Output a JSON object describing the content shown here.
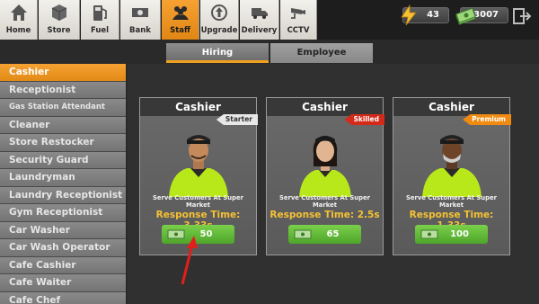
{
  "nav": {
    "items": [
      {
        "label": "Home",
        "icon": "home-icon"
      },
      {
        "label": "Store",
        "icon": "box-icon"
      },
      {
        "label": "Fuel",
        "icon": "fuel-pump-icon"
      },
      {
        "label": "Bank",
        "icon": "cash-icon"
      },
      {
        "label": "Staff",
        "icon": "staff-icon"
      },
      {
        "label": "Upgrade",
        "icon": "upgrade-icon"
      },
      {
        "label": "Delivery",
        "icon": "truck-icon"
      },
      {
        "label": "CCTV",
        "icon": "camera-icon"
      }
    ],
    "active": "Staff"
  },
  "resources": {
    "energy": "43",
    "cash": "$3007"
  },
  "tabs": [
    {
      "label": "Hiring"
    },
    {
      "label": "Employee"
    }
  ],
  "sidebar": {
    "items": [
      {
        "label": "Cashier"
      },
      {
        "label": "Receptionist"
      },
      {
        "label": "Gas Station Attendant"
      },
      {
        "label": "Cleaner"
      },
      {
        "label": "Store Restocker"
      },
      {
        "label": "Security Guard"
      },
      {
        "label": "Laundryman"
      },
      {
        "label": "Laundry Receptionist"
      },
      {
        "label": "Gym Receptionist"
      },
      {
        "label": "Car Washer"
      },
      {
        "label": "Car Wash Operator"
      },
      {
        "label": "Cafe Cashier"
      },
      {
        "label": "Cafe Waiter"
      },
      {
        "label": "Cafe Chef"
      }
    ],
    "active": "Cashier"
  },
  "cards": [
    {
      "title": "Cashier",
      "tier": "Starter",
      "description": "Serve Customers At Super Market",
      "response": "Response Time: 3.33s",
      "price": "50"
    },
    {
      "title": "Cashier",
      "tier": "Skilled",
      "description": "Serve Customers At Super Market",
      "response": "Response Time: 2.5s",
      "price": "65"
    },
    {
      "title": "Cashier",
      "tier": "Premium",
      "description": "Serve Customers At Super Market",
      "response": "Response Time: 1.33s",
      "price": "100"
    }
  ],
  "colors": {
    "accent": "#f0a020",
    "button_green": "#5fb835",
    "response_yellow": "#f6c132",
    "arrow_red": "#e0201c"
  }
}
